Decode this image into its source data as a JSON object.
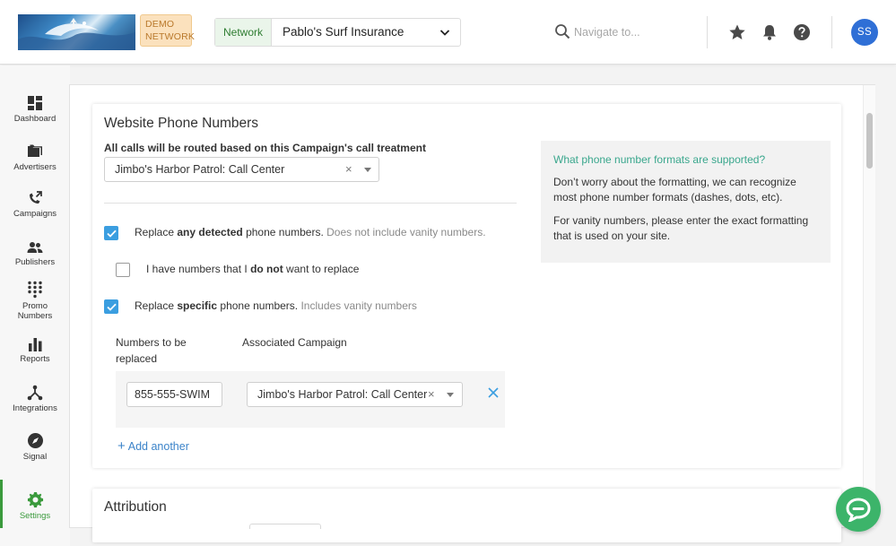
{
  "header": {
    "demo_badge_line1": "DEMO",
    "demo_badge_line2": "NETWORK",
    "network_label": "Network",
    "network_value": "Pablo's Surf Insurance",
    "search_placeholder": "Navigate to...",
    "avatar_initials": "SS"
  },
  "sidebar": {
    "items": [
      {
        "label": "Dashboard",
        "icon": "dashboard-icon"
      },
      {
        "label": "Advertisers",
        "icon": "folder-icon"
      },
      {
        "label": "Campaigns",
        "icon": "phone-forward-icon"
      },
      {
        "label": "Publishers",
        "icon": "people-icon"
      },
      {
        "label_line1": "Promo",
        "label_line2": "Numbers",
        "icon": "dialpad-icon"
      },
      {
        "label": "Reports",
        "icon": "bar-chart-icon"
      },
      {
        "label": "Integrations",
        "icon": "hub-icon"
      },
      {
        "label": "Signal",
        "icon": "compass-icon"
      },
      {
        "label": "Settings",
        "icon": "gear-icon",
        "active": true
      }
    ]
  },
  "website_phone_numbers": {
    "title": "Website Phone Numbers",
    "routed_label": "All calls will be routed based on this Campaign's call treatment",
    "routed_select_value": "Jimbo's Harbor Patrol: Call Center",
    "option1": {
      "pre": "Replace ",
      "bold": "any detected",
      "post": " phone numbers.",
      "muted": " Does not include vanity numbers.",
      "checked": true
    },
    "option2": {
      "pre": "I have numbers that I ",
      "bold": "do not",
      "post": " want to replace",
      "checked": false
    },
    "option3": {
      "pre": "Replace ",
      "bold": "specific",
      "post": " phone numbers.",
      "muted": " Includes vanity numbers",
      "checked": true
    },
    "col_numbers_line1": "Numbers to be",
    "col_numbers_line2": "replaced",
    "col_campaign": "Associated Campaign",
    "row": {
      "number": "855-555-SWIM",
      "campaign": "Jimbo's Harbor Patrol: Call Center"
    },
    "add_another": "Add another",
    "clear_glyph": "×",
    "plus_glyph": "+"
  },
  "info": {
    "title": "What phone number formats are supported?",
    "p1": "Don’t worry about the formatting, we can recognize most phone number formats (dashes, dots, etc).",
    "p2": "For vanity numbers, please enter the exact formatting that is used on your site."
  },
  "attribution": {
    "title": "Attribution"
  },
  "colors": {
    "accent_blue": "#3b9ee0",
    "link_blue": "#3b83c9",
    "info_green": "#3aa78d",
    "active_green": "#3a9a3c",
    "chat_green": "#3cb46a",
    "avatar_blue": "#2f6fd6"
  }
}
